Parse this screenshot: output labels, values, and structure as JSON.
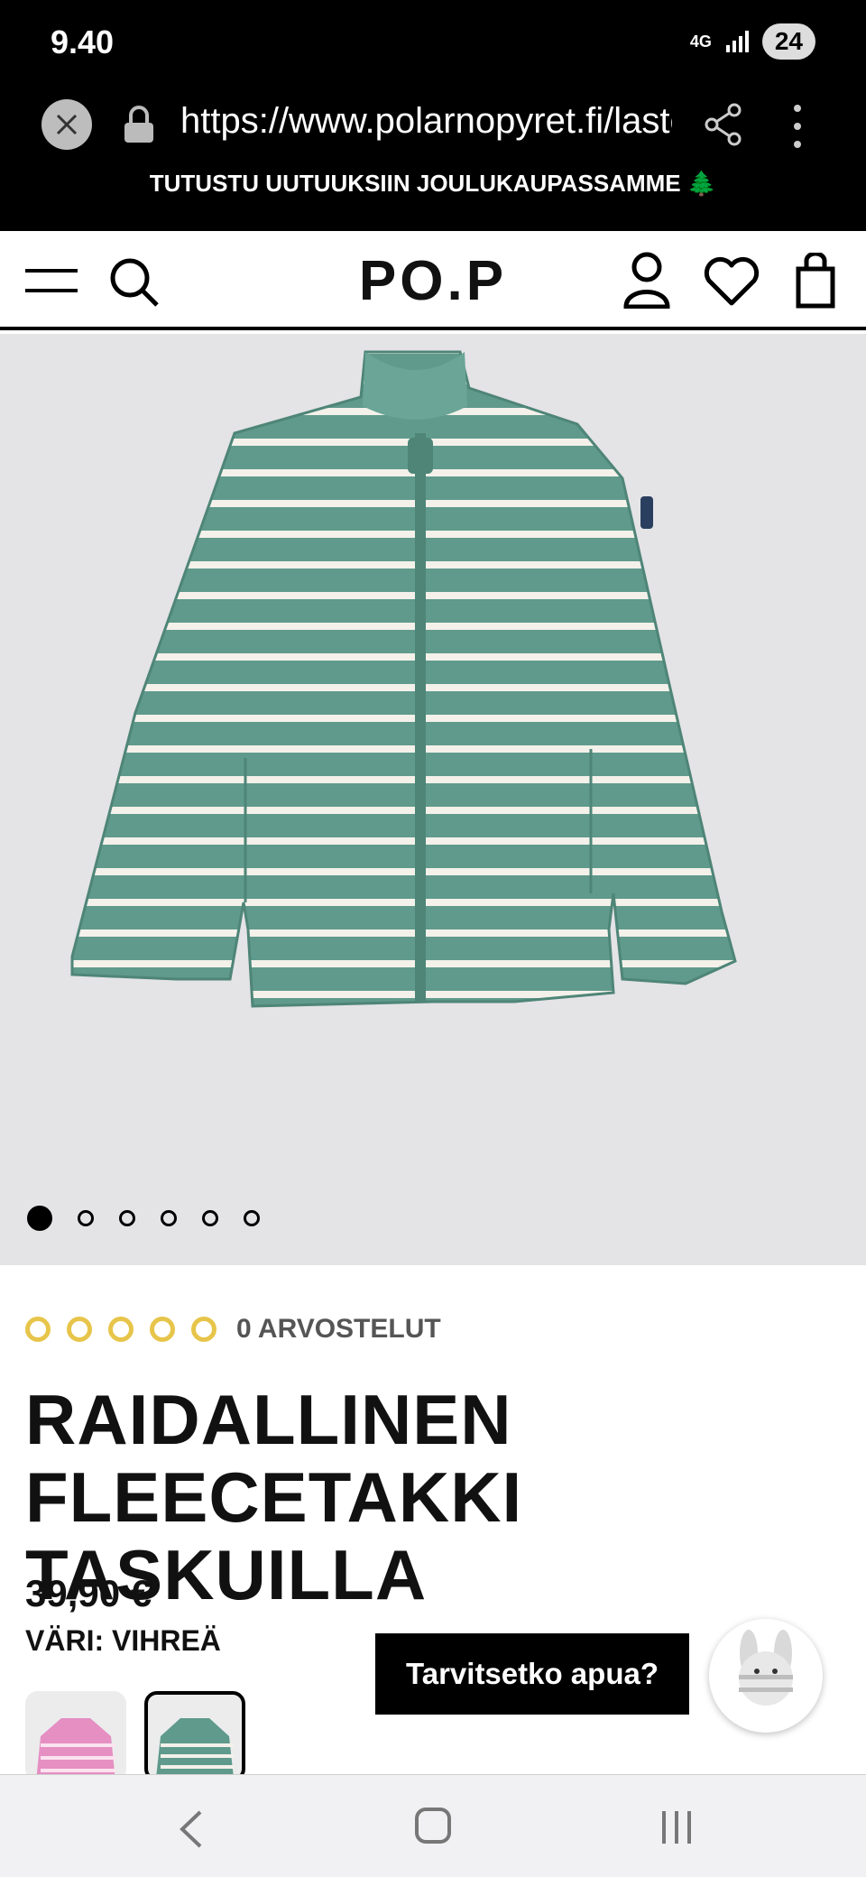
{
  "status_bar": {
    "time": "9.40",
    "network": "4G",
    "battery": "24"
  },
  "browser": {
    "url": "https://www.polarnopyret.fi/lastenvaatteet"
  },
  "announcement": {
    "line1": "TUTUSTU UUTUUKSIIN JOULUKAUPASSAMME 🌲",
    "line2": ""
  },
  "header": {
    "logo": "PO.P"
  },
  "gallery": {
    "slides": 6,
    "active": 1
  },
  "rating": {
    "stars": 5,
    "text": "0 ARVOSTELUT"
  },
  "product": {
    "title": "RAIDALLINEN FLEECETAKKI TASKUILLA",
    "price": "39,90 €",
    "color_label": "VÄRI: VIHREÄ"
  },
  "chat": {
    "help_label": "Tarvitsetko apua?"
  },
  "colors": {
    "jacket": "#5f9a8c",
    "stripe": "#f3f1ea",
    "star": "#e7c54a",
    "hero_bg": "#e4e3e6"
  }
}
